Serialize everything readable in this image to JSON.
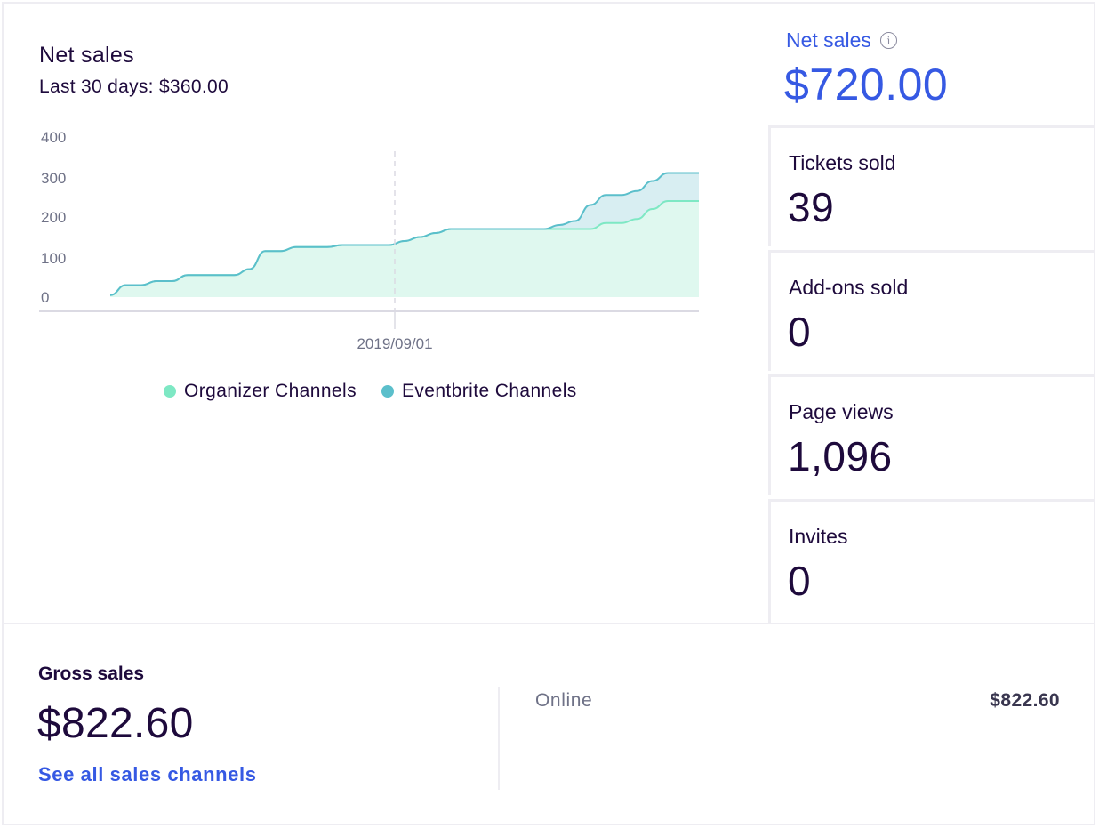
{
  "chart": {
    "title": "Net sales",
    "subtitle": "Last 30 days: $360.00"
  },
  "chart_data": {
    "type": "area",
    "stacked": true,
    "ylim": [
      0,
      400
    ],
    "yticks": [
      "400",
      "300",
      "200",
      "100",
      "0"
    ],
    "x_tick_label": "2019/09/01",
    "grid": false,
    "legend_position": "bottom",
    "steps": [
      0,
      1,
      2,
      3,
      4,
      5,
      6,
      7,
      8,
      9,
      10,
      11,
      12,
      13,
      14,
      15,
      16,
      17,
      18,
      19,
      20,
      21,
      22,
      23,
      24,
      25,
      26,
      27,
      28,
      29,
      30,
      31,
      32,
      33,
      34,
      35,
      36,
      37,
      38
    ],
    "series": [
      {
        "name": "Organizer Channels",
        "color": "#7ee8c4",
        "fill": "#dff8ef",
        "values": [
          5,
          30,
          30,
          40,
          40,
          55,
          55,
          55,
          55,
          70,
          115,
          115,
          125,
          125,
          125,
          130,
          130,
          130,
          130,
          140,
          150,
          160,
          170,
          170,
          170,
          170,
          170,
          170,
          170,
          170,
          170,
          170,
          185,
          185,
          195,
          220,
          240,
          240,
          240
        ]
      },
      {
        "name": "Eventbrite Channels",
        "color": "#5bbfcb",
        "fill": "#d8eef2",
        "values": [
          0,
          0,
          0,
          0,
          0,
          0,
          0,
          0,
          0,
          0,
          0,
          0,
          0,
          0,
          0,
          0,
          0,
          0,
          0,
          0,
          0,
          0,
          0,
          0,
          0,
          0,
          0,
          0,
          0,
          10,
          20,
          60,
          70,
          70,
          70,
          70,
          70,
          70,
          70
        ]
      }
    ]
  },
  "net_sales": {
    "label": "Net sales",
    "value": "$720.00",
    "info_icon": "info-icon"
  },
  "stats": [
    {
      "label": "Tickets sold",
      "value": "39"
    },
    {
      "label": "Add-ons sold",
      "value": "0"
    },
    {
      "label": "Page views",
      "value": "1,096"
    },
    {
      "label": "Invites",
      "value": "0"
    }
  ],
  "gross": {
    "label": "Gross sales",
    "value": "$822.60",
    "link": "See all sales channels",
    "channel_label": "Online",
    "channel_value": "$822.60"
  },
  "colors": {
    "accent": "#3659e3",
    "text": "#1e0a3c",
    "organizer": "#7ee8c4",
    "eventbrite": "#5bbfcb"
  }
}
